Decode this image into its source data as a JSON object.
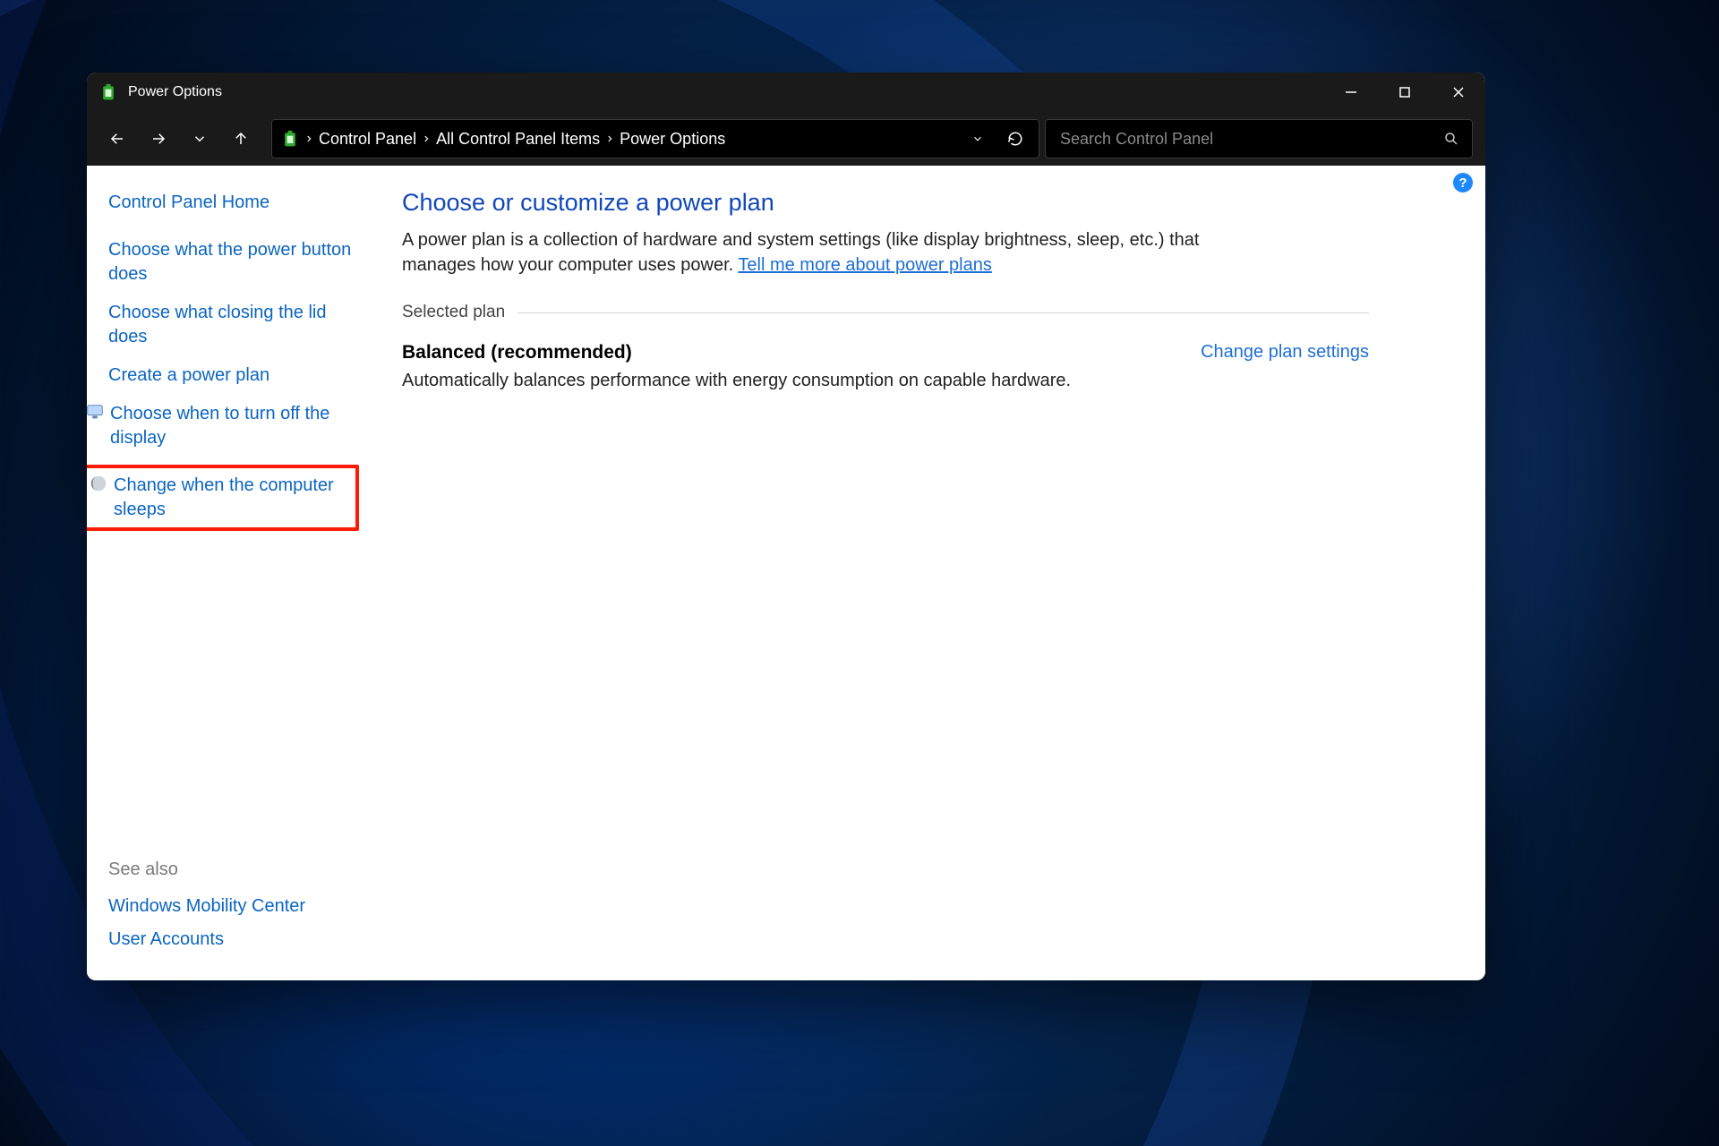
{
  "window": {
    "title": "Power Options"
  },
  "breadcrumb": {
    "items": [
      "Control Panel",
      "All Control Panel Items",
      "Power Options"
    ]
  },
  "search": {
    "placeholder": "Search Control Panel"
  },
  "sidebar": {
    "home": "Control Panel Home",
    "tasks": [
      {
        "label": "Choose what the power button does",
        "icon": null,
        "highlight": false
      },
      {
        "label": "Choose what closing the lid does",
        "icon": null,
        "highlight": false
      },
      {
        "label": "Create a power plan",
        "icon": null,
        "highlight": false
      },
      {
        "label": "Choose when to turn off the display",
        "icon": "monitor-icon",
        "highlight": false
      },
      {
        "label": "Change when the computer sleeps",
        "icon": "moon-icon",
        "highlight": true
      }
    ],
    "see_also_heading": "See also",
    "see_also": [
      {
        "label": "Windows Mobility Center"
      },
      {
        "label": "User Accounts"
      }
    ]
  },
  "main": {
    "heading": "Choose or customize a power plan",
    "description_pre": "A power plan is a collection of hardware and system settings (like display brightness, sleep, etc.) that manages how your computer uses power. ",
    "description_link": "Tell me more about power plans",
    "selected_plan_legend": "Selected plan",
    "plan": {
      "name": "Balanced (recommended)",
      "change_link": "Change plan settings",
      "description": "Automatically balances performance with energy consumption on capable hardware."
    }
  },
  "help_badge": "?"
}
